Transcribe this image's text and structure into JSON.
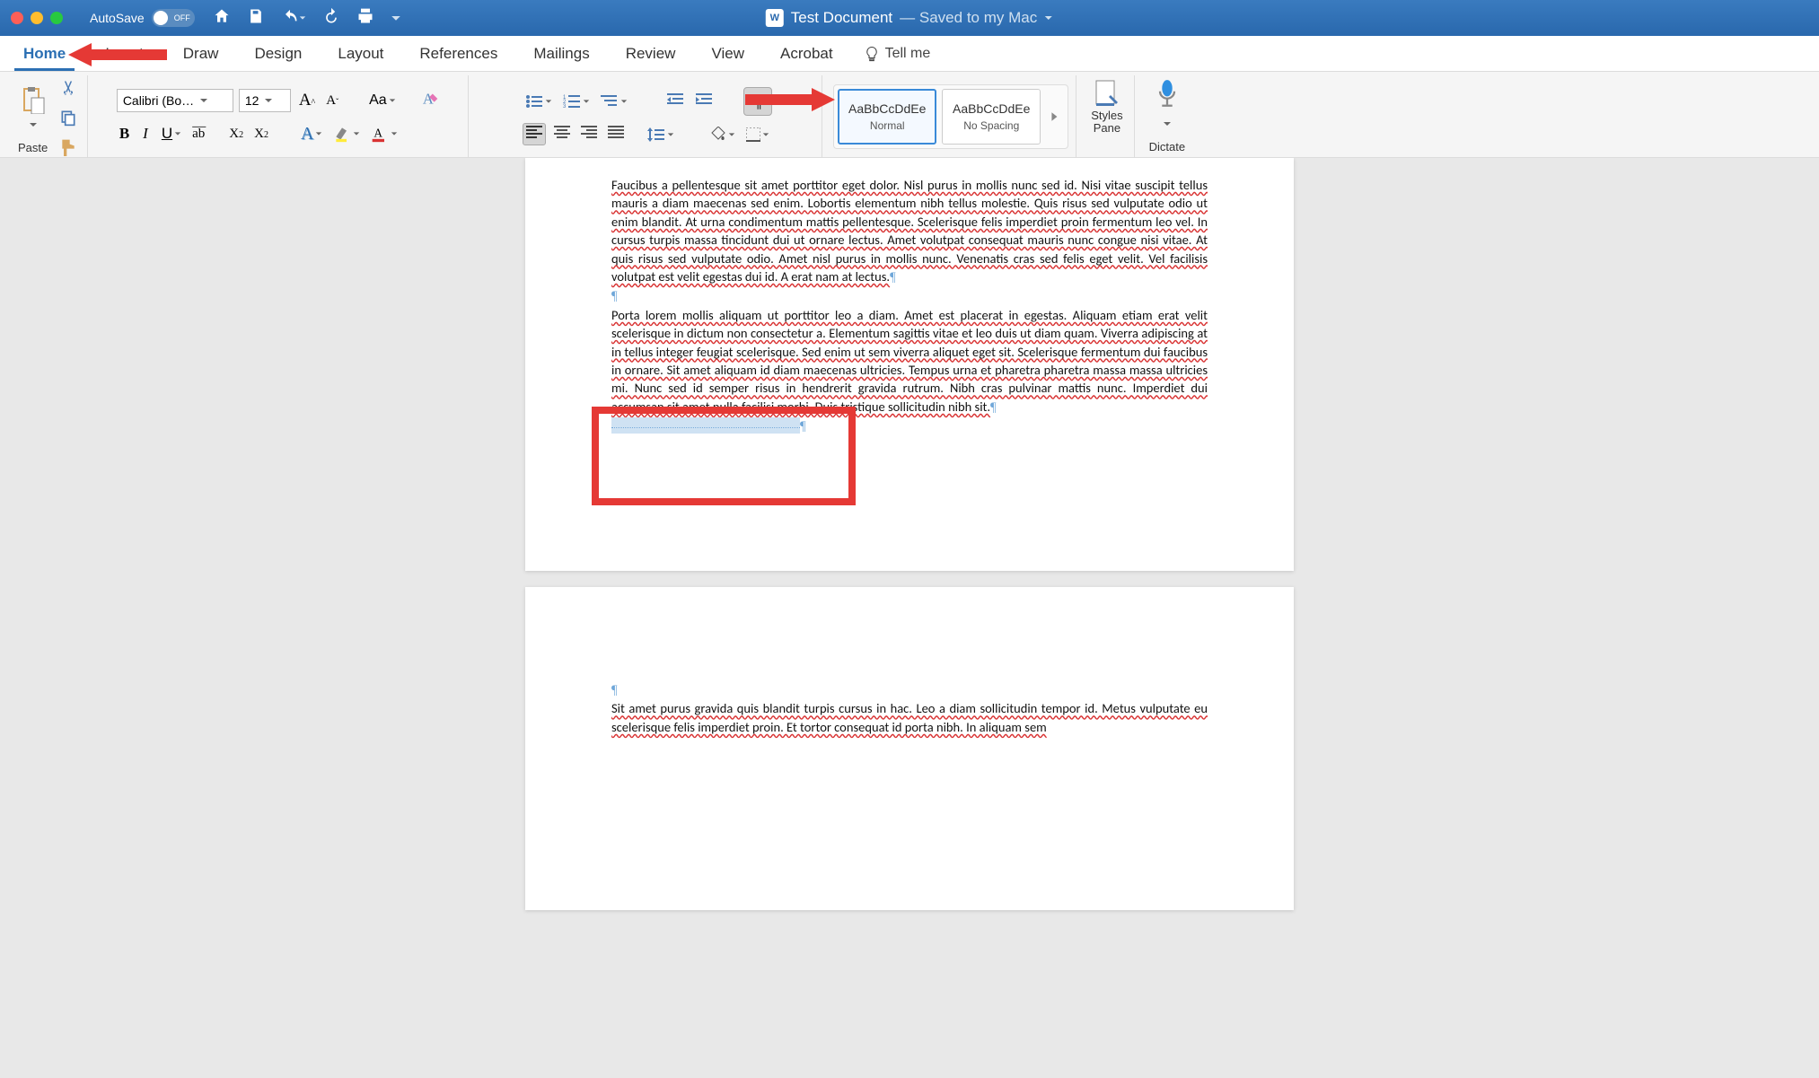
{
  "titlebar": {
    "autosave_label": "AutoSave",
    "autosave_state": "OFF",
    "doc_title": "Test Document",
    "saved_status": " — Saved to my Mac"
  },
  "tabs": [
    "Home",
    "Insert",
    "Draw",
    "Design",
    "Layout",
    "References",
    "Mailings",
    "Review",
    "View",
    "Acrobat"
  ],
  "active_tab": "Home",
  "tellme_label": "Tell me",
  "ribbon": {
    "paste_label": "Paste",
    "font_name": "Calibri (Bo…",
    "font_size": "12",
    "increase_font": "A",
    "decrease_font": "A",
    "change_case": "Aa",
    "styles_pane_label": "Styles\nPane",
    "dictate_label": "Dictate",
    "style1_preview": "AaBbCcDdEe",
    "style1_name": "Normal",
    "style2_preview": "AaBbCcDdEe",
    "style2_name": "No Spacing"
  },
  "document": {
    "para1": "Faucibus a pellentesque sit amet porttitor eget dolor. Nisl purus in mollis nunc sed id. Nisi vitae suscipit tellus mauris a diam maecenas sed enim. Lobortis elementum nibh tellus molestie. Quis risus sed vulputate odio ut enim blandit. At urna condimentum mattis pellentesque. Scelerisque felis imperdiet proin fermentum leo vel. In cursus turpis massa tincidunt dui ut ornare lectus. Amet volutpat consequat mauris nunc congue nisi vitae. At quis risus sed vulputate odio. Amet nisl purus in mollis nunc. Venenatis cras sed felis eget velit. Vel facilisis volutpat est velit egestas dui id. A erat nam at lectus.",
    "para2": "Porta lorem mollis aliquam ut porttitor leo a diam. Amet est placerat in egestas. Aliquam etiam erat velit scelerisque in dictum non consectetur a. Elementum sagittis vitae et leo duis ut diam quam. Viverra adipiscing at in tellus integer feugiat scelerisque. Sed enim ut sem viverra aliquet eget sit. Scelerisque fermentum dui faucibus in ornare. Sit amet aliquam id diam maecenas ultricies. Tempus urna et pharetra pharetra massa massa ultricies mi. Nunc sed id semper risus in hendrerit gravida rutrum. Nibh cras pulvinar mattis nunc. Imperdiet dui accumsan sit amet nulla facilisi morbi. Duis tristique sollicitudin nibh sit.",
    "para3_a": "Sit amet purus gravida quis blandit turpis cursus in hac. Leo a diam sollicitudin tempor id. Metus vulputate eu scelerisque felis imperdiet proin. Et tortor consequat id porta nibh. In aliquam sem",
    "pilcrow": "¶"
  }
}
